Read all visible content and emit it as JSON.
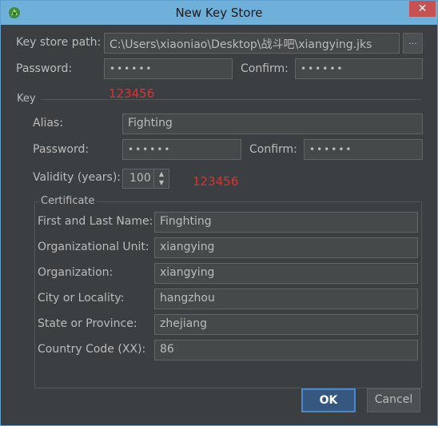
{
  "window": {
    "title": "New Key Store",
    "close_glyph": "✕"
  },
  "keystore": {
    "path_label": "Key store path:",
    "path_value": "C:\\Users\\xiaoniao\\Desktop\\战斗吧\\xiangying.jks",
    "browse_label": "...",
    "password_label": "Password:",
    "password_mask": "••••••",
    "confirm_label": "Confirm:",
    "confirm_mask": "••••••"
  },
  "annotations": {
    "note1": "123456",
    "note2": "123456"
  },
  "key": {
    "group_title": "Key",
    "alias_label": "Alias:",
    "alias_value": "Fighting",
    "password_label": "Password:",
    "password_mask": "••••••",
    "confirm_label": "Confirm:",
    "confirm_mask": "••••••",
    "validity_label": "Validity (years):",
    "validity_value": "100"
  },
  "certificate": {
    "group_title": "Certificate",
    "first_last_label": "First and Last Name:",
    "first_last_value": "Finghting",
    "org_unit_label": "Organizational Unit:",
    "org_unit_value": "xiangying",
    "org_label": "Organization:",
    "org_value": "xiangying",
    "city_label": "City or Locality:",
    "city_value": "hangzhou",
    "state_label": "State or Province:",
    "state_value": "zhejiang",
    "country_label": "Country Code (XX):",
    "country_value": "86"
  },
  "buttons": {
    "ok": "OK",
    "cancel": "Cancel"
  },
  "colors": {
    "titlebar": "#6fb0db",
    "background": "#3c3f41",
    "annotation": "#e03030",
    "ok_button": "#365880"
  }
}
